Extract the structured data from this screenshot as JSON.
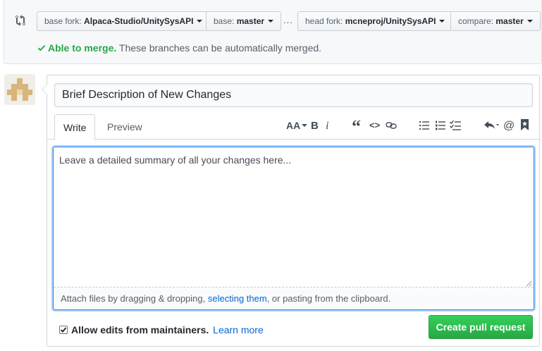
{
  "compare": {
    "base_fork_label": "base fork:",
    "base_fork_value": "Alpaca-Studio/UnitySysAPI",
    "base_label": "base:",
    "base_value": "master",
    "separator": "...",
    "head_fork_label": "head fork:",
    "head_fork_value": "mcneproj/UnitySysAPI",
    "compare_label": "compare:",
    "compare_value": "master",
    "merge_status": "Able to merge.",
    "merge_detail": "These branches can be automatically merged."
  },
  "form": {
    "title_value": "Brief Description of New Changes",
    "tabs": [
      {
        "label": "Write",
        "active": true
      },
      {
        "label": "Preview",
        "active": false
      }
    ],
    "toolbar": {
      "header_text": "AA",
      "bold_text": "B",
      "italic_text": "i",
      "quote_text": "“",
      "code_text": "<>",
      "mention_text": "@"
    },
    "body_placeholder": "Leave a detailed summary of all your changes here...",
    "attach_prefix": "Attach files by dragging & dropping, ",
    "attach_link": "selecting them",
    "attach_suffix": ", or pasting from the clipboard.",
    "maintainer_checkbox_checked": true,
    "maintainer_label": "Allow edits from maintainers.",
    "learn_more": "Learn more",
    "submit_label": "Create pull request"
  },
  "colors": {
    "accent_green": "#28a745",
    "link_blue": "#0366d6",
    "focus_blue": "#2188ff"
  },
  "icons": [
    "compare-icon",
    "check-icon",
    "caret-down-icon",
    "avatar-identicon",
    "text-size-icon",
    "bold-icon",
    "italic-icon",
    "quote-icon",
    "code-icon",
    "link-icon",
    "unordered-list-icon",
    "ordered-list-icon",
    "task-list-icon",
    "reply-icon",
    "mention-icon",
    "bookmark-icon",
    "resize-handle-icon"
  ]
}
